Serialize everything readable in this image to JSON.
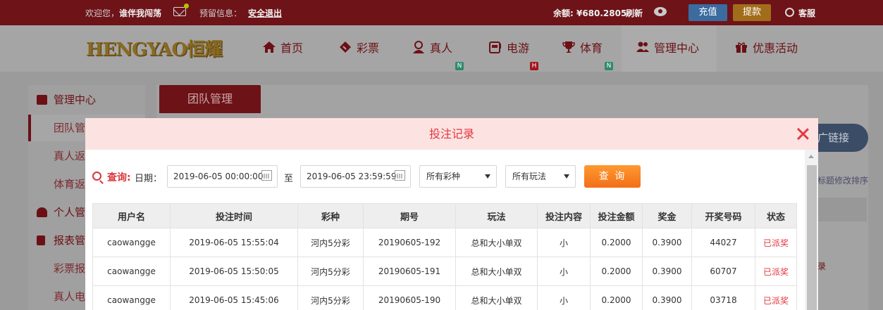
{
  "topbar": {
    "welcome": "欢迎您，",
    "username": "谁伴我闯荡",
    "notice_label": "预留信息：",
    "logout": "安全退出",
    "balance": "余额: ¥680.2805",
    "refresh": "刷新",
    "deposit": "充值",
    "withdraw": "提款",
    "customer_service": "客服"
  },
  "logo_text": "HENGYAO恒耀",
  "nav": [
    {
      "label": "首页",
      "icon": "home-icon"
    },
    {
      "label": "彩票",
      "icon": "ticket-icon"
    },
    {
      "label": "真人",
      "icon": "live-dealer-icon",
      "badge": "N"
    },
    {
      "label": "电游",
      "icon": "slot-machine-icon",
      "badge": "H"
    },
    {
      "label": "体育",
      "icon": "trophy-icon",
      "badge": "N"
    },
    {
      "label": "管理中心",
      "icon": "users-icon"
    },
    {
      "label": "优惠活动",
      "icon": "gift-icon"
    }
  ],
  "sidebar": {
    "items": [
      "管理中心",
      "团队管",
      "真人返",
      "体育返",
      "个人管",
      "报表管",
      "彩票报",
      "真人电"
    ]
  },
  "page": {
    "team_tab": "团队管理",
    "promo_link": "广链接",
    "sort_hint": "标题修改排序",
    "record_text": "录"
  },
  "modal": {
    "title": "投注记录",
    "filters": {
      "query_label": "查询:",
      "date_label": "日期：",
      "start": "2019-06-05 00:00:00",
      "to_label": "至",
      "end": "2019-06-05 23:59:59",
      "lottery_select": "所有彩种",
      "play_select": "所有玩法",
      "query_button": "查 询"
    },
    "table": {
      "columns": [
        "用户名",
        "投注时间",
        "彩种",
        "期号",
        "玩法",
        "投注内容",
        "投注金额",
        "奖金",
        "开奖号码",
        "状态"
      ],
      "rows": [
        [
          "caowangge",
          "2019-06-05 15:55:04",
          "河内5分彩",
          "20190605-192",
          "总和大小单双",
          "小",
          "0.2000",
          "0.3900",
          "44027",
          "已派奖"
        ],
        [
          "caowangge",
          "2019-06-05 15:50:05",
          "河内5分彩",
          "20190605-191",
          "总和大小单双",
          "小",
          "0.2000",
          "0.3900",
          "60707",
          "已派奖"
        ],
        [
          "caowangge",
          "2019-06-05 15:45:06",
          "河内5分彩",
          "20190605-190",
          "总和大小单双",
          "小",
          "0.2000",
          "0.3900",
          "03718",
          "已派奖"
        ]
      ]
    }
  },
  "colors": {
    "brand_dark": "#6e1318",
    "modal_header_bg": "#fde2e2",
    "accent_red": "#e0383e",
    "query_orange": "#f58a25"
  }
}
